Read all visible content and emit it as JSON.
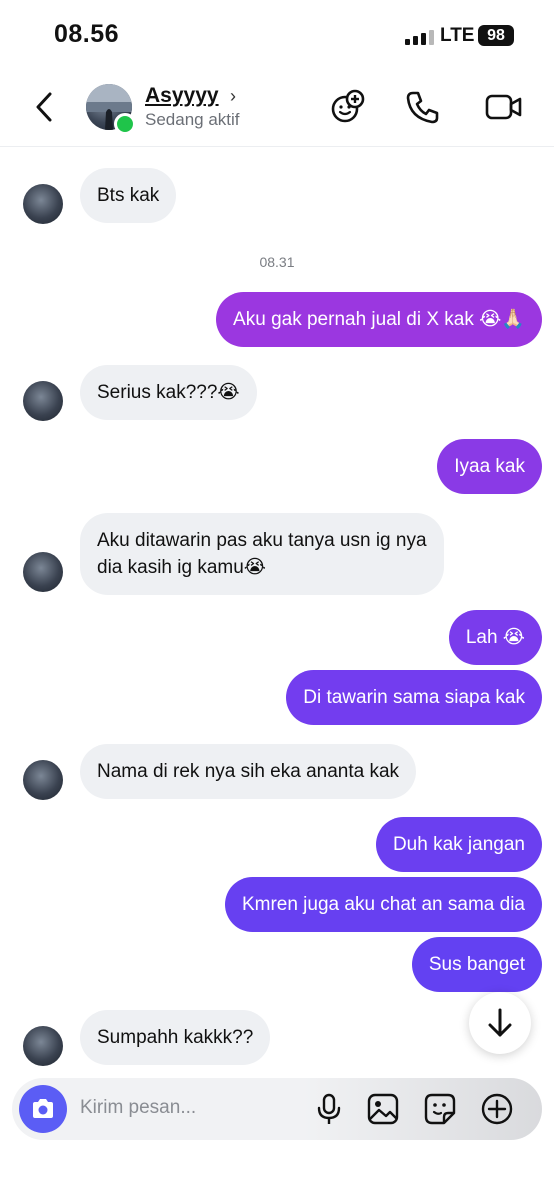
{
  "status_bar": {
    "time": "08.56",
    "network": "LTE",
    "battery": "98"
  },
  "header": {
    "name": "Asyyyy",
    "chevron": "›",
    "status": "Sedang aktif"
  },
  "header_icons": [
    "back-icon",
    "sticker-add-icon",
    "phone-icon",
    "video-call-icon"
  ],
  "colors": {
    "outgoing_top": "#9b37e0",
    "outgoing_bottom": "#6a3ff0",
    "incoming": "#eef0f3",
    "online": "#1fc44a",
    "accent": "#5b5df5"
  },
  "messages": [
    {
      "side": "in",
      "text": "Bts kak"
    },
    {
      "side": "out",
      "text": "Aku gak pernah jual di X kak 😭🙏🏻"
    },
    {
      "side": "in",
      "text": "Serius kak???😭"
    },
    {
      "side": "out",
      "text": "Iyaa kak"
    },
    {
      "side": "in",
      "line1": "Aku ditawarin pas aku tanya usn ig nya",
      "line2": "dia kasih ig kamu😭"
    },
    {
      "side": "out",
      "text": "Lah 😭"
    },
    {
      "side": "out",
      "text": "Di tawarin sama siapa kak"
    },
    {
      "side": "in",
      "text": "Nama di rek nya sih eka ananta kak"
    },
    {
      "side": "out",
      "text": "Duh kak jangan"
    },
    {
      "side": "out",
      "text": "Kmren juga aku chat an sama dia"
    },
    {
      "side": "out",
      "text": "Sus banget"
    },
    {
      "side": "in",
      "text": "Sumpahh kakkk??"
    }
  ],
  "timestamp": "08.31",
  "composer": {
    "placeholder": "Kirim pesan...",
    "icons": [
      "camera-icon",
      "microphone-icon",
      "gallery-icon",
      "sticker-icon",
      "plus-icon"
    ]
  }
}
